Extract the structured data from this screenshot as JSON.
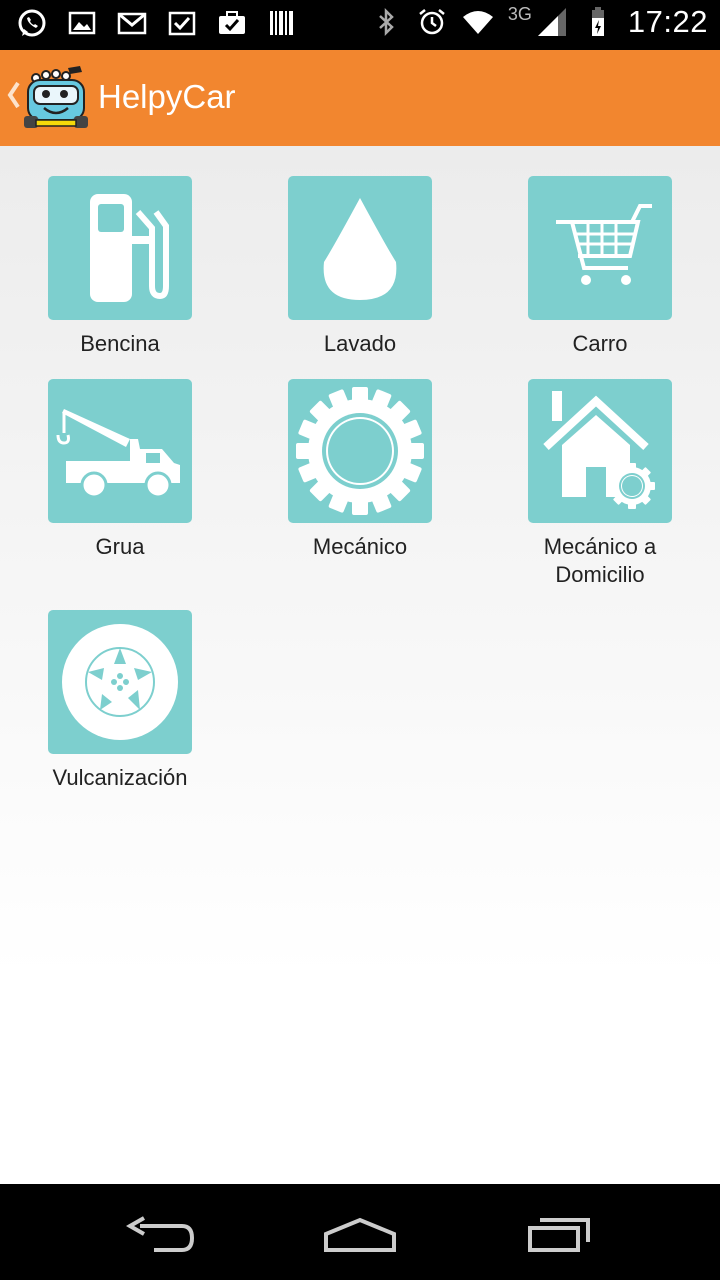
{
  "status_bar": {
    "left_icons": [
      "whatsapp-icon",
      "gallery-icon",
      "gmail-icon",
      "task-check-icon",
      "briefcase-check-icon",
      "barcode-icon"
    ],
    "right_icons": [
      "bluetooth-icon",
      "alarm-icon",
      "wifi-icon",
      "signal-icon",
      "battery-icon"
    ],
    "network": "3G",
    "time": "17:22"
  },
  "action_bar": {
    "title": "HelpyCar",
    "color": "#f2862f"
  },
  "tile_color": "#7dcfce",
  "tiles": [
    {
      "label": "Bencina",
      "icon": "fuel-pump-icon"
    },
    {
      "label": "Lavado",
      "icon": "water-drop-icon"
    },
    {
      "label": "Carro",
      "icon": "shopping-cart-icon"
    },
    {
      "label": "Grua",
      "icon": "tow-truck-icon"
    },
    {
      "label": "Mecánico",
      "icon": "gear-icon"
    },
    {
      "label": "Mecánico a Domicilio",
      "icon": "house-gear-icon"
    },
    {
      "label": "Vulcanización",
      "icon": "tire-wheel-icon"
    }
  ],
  "nav_bar": [
    "back-icon",
    "home-icon",
    "recent-apps-icon"
  ]
}
